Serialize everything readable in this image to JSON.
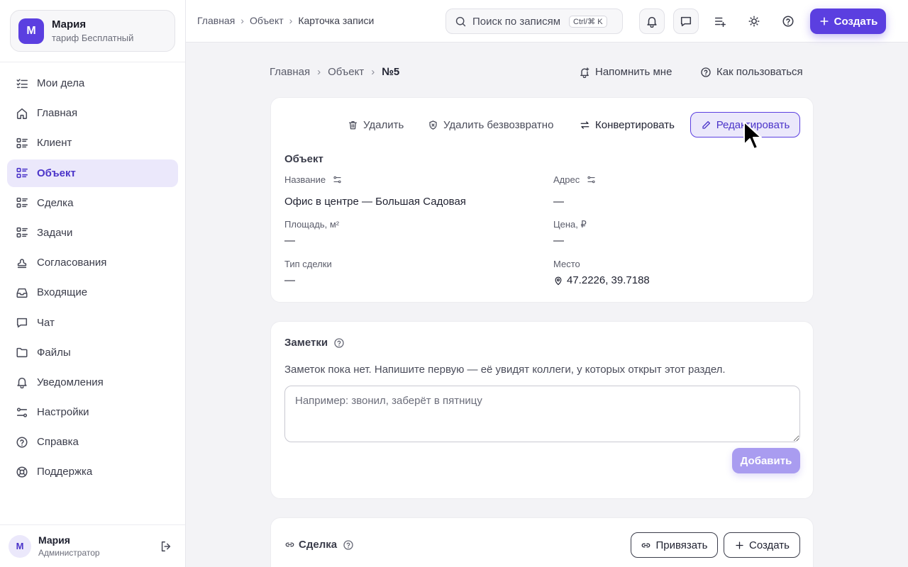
{
  "sidebar": {
    "profile": {
      "initial": "М",
      "name": "Мария",
      "plan": "тариф Бесплатный"
    },
    "items": [
      {
        "label": "Мои дела",
        "icon": "list-check-icon"
      },
      {
        "label": "Главная",
        "icon": "home-icon"
      },
      {
        "label": "Клиент",
        "icon": "grid-list-icon"
      },
      {
        "label": "Объект",
        "icon": "grid-list-icon",
        "active": true
      },
      {
        "label": "Сделка",
        "icon": "grid-list-icon"
      },
      {
        "label": "Задачи",
        "icon": "grid-list-icon"
      },
      {
        "label": "Согласования",
        "icon": "stamp-icon"
      },
      {
        "label": "Входящие",
        "icon": "inbox-icon"
      },
      {
        "label": "Чат",
        "icon": "chat-icon"
      },
      {
        "label": "Файлы",
        "icon": "folder-icon"
      },
      {
        "label": "Уведомления",
        "icon": "bell-icon"
      },
      {
        "label": "Настройки",
        "icon": "sliders-icon"
      },
      {
        "label": "Справка",
        "icon": "help-circle-icon"
      },
      {
        "label": "Поддержка",
        "icon": "lifebuoy-icon"
      }
    ],
    "footer": {
      "initial": "М",
      "name": "Мария",
      "role": "Администратор"
    }
  },
  "topbar": {
    "breadcrumbs": [
      "Главная",
      "Объект",
      "Карточка записи"
    ],
    "search_placeholder": "Поиск по записям",
    "search_shortcut": "Ctrl/⌘ K",
    "create_label": "Создать"
  },
  "page": {
    "breadcrumbs": [
      "Главная",
      "Объект",
      "№5"
    ],
    "remind_label": "Напомнить мне",
    "howto_label": "Как пользоваться"
  },
  "record": {
    "actions": {
      "delete": "Удалить",
      "delete_forever": "Удалить безвозвратно",
      "convert": "Конвертировать",
      "edit": "Редактировать"
    },
    "section_title": "Объект",
    "fields": {
      "name": {
        "label": "Название",
        "value": "Офис в центре — Большая Садовая"
      },
      "address": {
        "label": "Адрес",
        "value": "—"
      },
      "area": {
        "label": "Площадь, м²",
        "value": "—"
      },
      "price": {
        "label": "Цена, ₽",
        "value": "—"
      },
      "deal_type": {
        "label": "Тип сделки",
        "value": "—"
      },
      "place": {
        "label": "Место",
        "value": "47.2226, 39.7188"
      }
    }
  },
  "notes": {
    "title": "Заметки",
    "empty_text": "Заметок пока нет. Напишите первую — её увидят коллеги, у которых открыт этот раздел.",
    "placeholder": "Например: звонил, заберёт в пятницу",
    "add_label": "Добавить"
  },
  "deal": {
    "title": "Сделка",
    "link_label": "Привязать",
    "create_label": "Создать"
  },
  "colors": {
    "accent": "#5b3fe0",
    "accent_soft": "#ebe8fb",
    "accent_text": "#4b34c9"
  }
}
